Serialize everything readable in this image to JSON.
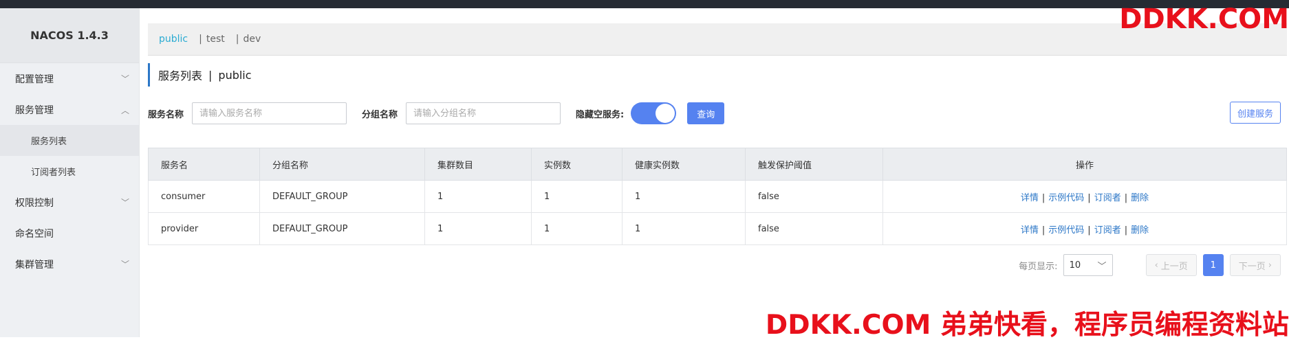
{
  "app": {
    "brand": "NACOS 1.4.3"
  },
  "sidebar": {
    "items": [
      {
        "label": "配置管理"
      },
      {
        "label": "服务管理"
      },
      {
        "label": "服务列表"
      },
      {
        "label": "订阅者列表"
      },
      {
        "label": "权限控制"
      },
      {
        "label": "命名空间"
      },
      {
        "label": "集群管理"
      }
    ]
  },
  "namespaces": [
    {
      "label": "public"
    },
    {
      "label": "test"
    },
    {
      "label": "dev"
    }
  ],
  "page": {
    "title": "服务列表",
    "namespace": "public"
  },
  "filter": {
    "service_label": "服务名称",
    "service_placeholder": "请输入服务名称",
    "group_label": "分组名称",
    "group_placeholder": "请输入分组名称",
    "hide_empty_label": "隐藏空服务:",
    "hide_empty_on": true,
    "query_label": "查询",
    "create_label": "创建服务"
  },
  "table": {
    "headers": [
      "服务名",
      "分组名称",
      "集群数目",
      "实例数",
      "健康实例数",
      "触发保护阈值",
      "操作"
    ],
    "rows": [
      [
        "consumer",
        "DEFAULT_GROUP",
        "1",
        "1",
        "1",
        "false"
      ],
      [
        "provider",
        "DEFAULT_GROUP",
        "1",
        "1",
        "1",
        "false"
      ]
    ],
    "actions": [
      "详情",
      "示例代码",
      "订阅者",
      "删除"
    ]
  },
  "pagination": {
    "page_size_label": "每页显示:",
    "page_size": "10",
    "prev_label": "上一页",
    "current_page": "1",
    "next_label": "下一页"
  },
  "watermark": {
    "top": "DDKK.COM",
    "bottom": "DDKK.COM 弟弟快看，程序员编程资料站"
  },
  "colors": {
    "accent": "#5582f0",
    "link": "#2c77c7",
    "ns_active": "#2aabd2",
    "watermark": "#e8101b"
  }
}
